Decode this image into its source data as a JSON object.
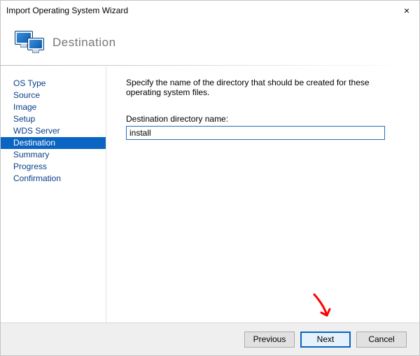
{
  "titlebar": {
    "title": "Import Operating System Wizard"
  },
  "banner": {
    "heading": "Destination"
  },
  "sidebar": {
    "items": [
      {
        "label": "OS Type",
        "selected": false
      },
      {
        "label": "Source",
        "selected": false
      },
      {
        "label": "Image",
        "selected": false
      },
      {
        "label": "Setup",
        "selected": false
      },
      {
        "label": "WDS Server",
        "selected": false
      },
      {
        "label": "Destination",
        "selected": true
      },
      {
        "label": "Summary",
        "selected": false
      },
      {
        "label": "Progress",
        "selected": false
      },
      {
        "label": "Confirmation",
        "selected": false
      }
    ]
  },
  "content": {
    "instruction": "Specify the name of the directory that should be created for these operating system files.",
    "field_label": "Destination directory name:",
    "field_value": "install"
  },
  "buttons": {
    "previous": "Previous",
    "next": "Next",
    "cancel": "Cancel"
  },
  "annotation": {
    "arrow_color": "#ff0000"
  }
}
